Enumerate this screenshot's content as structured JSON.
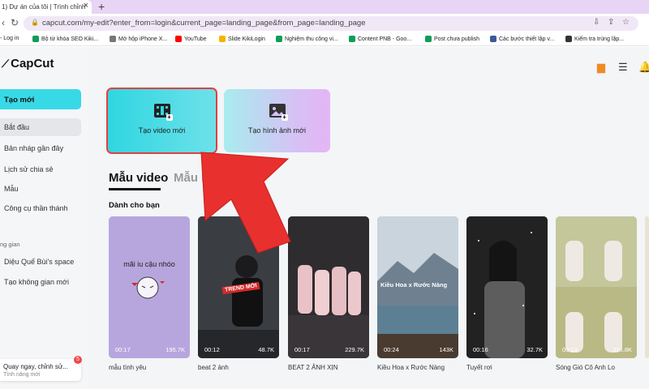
{
  "browser": {
    "tab_title": "1) Dự án của tôi | Trình chỉnh",
    "tab_close": "×",
    "new_tab": "+",
    "url": "capcut.com/my-edit?enter_from=login&current_page=landing_page&from_page=landing_page",
    "bookmarks": [
      {
        "label": "- Log in",
        "color": "#4285f4"
      },
      {
        "label": "Bộ từ khóa SEO Kiki...",
        "color": "#0f9d58"
      },
      {
        "label": "Mở hộp iPhone X...",
        "color": "#555555"
      },
      {
        "label": "YouTube",
        "color": "#ff0000"
      },
      {
        "label": "Slide KikiLogin",
        "color": "#f4b400"
      },
      {
        "label": "Nghiệm thu công vi...",
        "color": "#0f9d58"
      },
      {
        "label": "Content PNB - Goo...",
        "color": "#0f9d58"
      },
      {
        "label": "Post chưa publish",
        "color": "#0f9d58"
      },
      {
        "label": "Các bước thiết lập v...",
        "color": "#3b5998"
      },
      {
        "label": "Kiểm tra trùng lặp...",
        "color": "#333333"
      }
    ]
  },
  "app": {
    "logo": "CapCut",
    "sidebar": {
      "new_button": "Tạo mới",
      "items": [
        "Bắt đầu",
        "Bản nháp gần đây",
        "Lịch sử chia sẻ",
        "Mẫu",
        "Công cụ thần thánh"
      ],
      "section": "ng gian",
      "space_items": [
        "Diệu Quế Bùi's space",
        "Tạo không gian mới"
      ],
      "notice_title": "Quay ngay, chỉnh sử...",
      "notice_sub": "Tính năng mới",
      "notice_badge": "5"
    },
    "create": {
      "video_label": "Tạo video mới",
      "image_label": "Tạo hình ảnh mới"
    },
    "tabs": {
      "video": "Mẫu video",
      "image": "Mẫu hình"
    },
    "section_title": "Dành cho bạn",
    "templates": [
      {
        "name": "mẫu tình yêu",
        "duration": "00:17",
        "likes": "195.7K",
        "overlay": "mãi iu cậu nhóo"
      },
      {
        "name": "beat 2 ảnh",
        "duration": "00:12",
        "likes": "48.7K",
        "overlay": "TREND MỚI"
      },
      {
        "name": "BEAT 2 ẢNH XỊN",
        "duration": "00:17",
        "likes": "229.7K",
        "overlay": ""
      },
      {
        "name": "Kiều Hoa x Rước Nàng",
        "duration": "00:24",
        "likes": "143K",
        "overlay": "Kiều Hoa x Rước Nàng"
      },
      {
        "name": "Tuyết rơi",
        "duration": "00:16",
        "likes": "32.7K",
        "overlay": ""
      },
      {
        "name": "Sóng Gió Cô Anh Lo",
        "duration": "00:13",
        "likes": "316.8K",
        "overlay": ""
      }
    ]
  },
  "colors": {
    "accent": "#38d9e6",
    "arrow": "#e8302e",
    "highlight_border": "#e14040"
  }
}
